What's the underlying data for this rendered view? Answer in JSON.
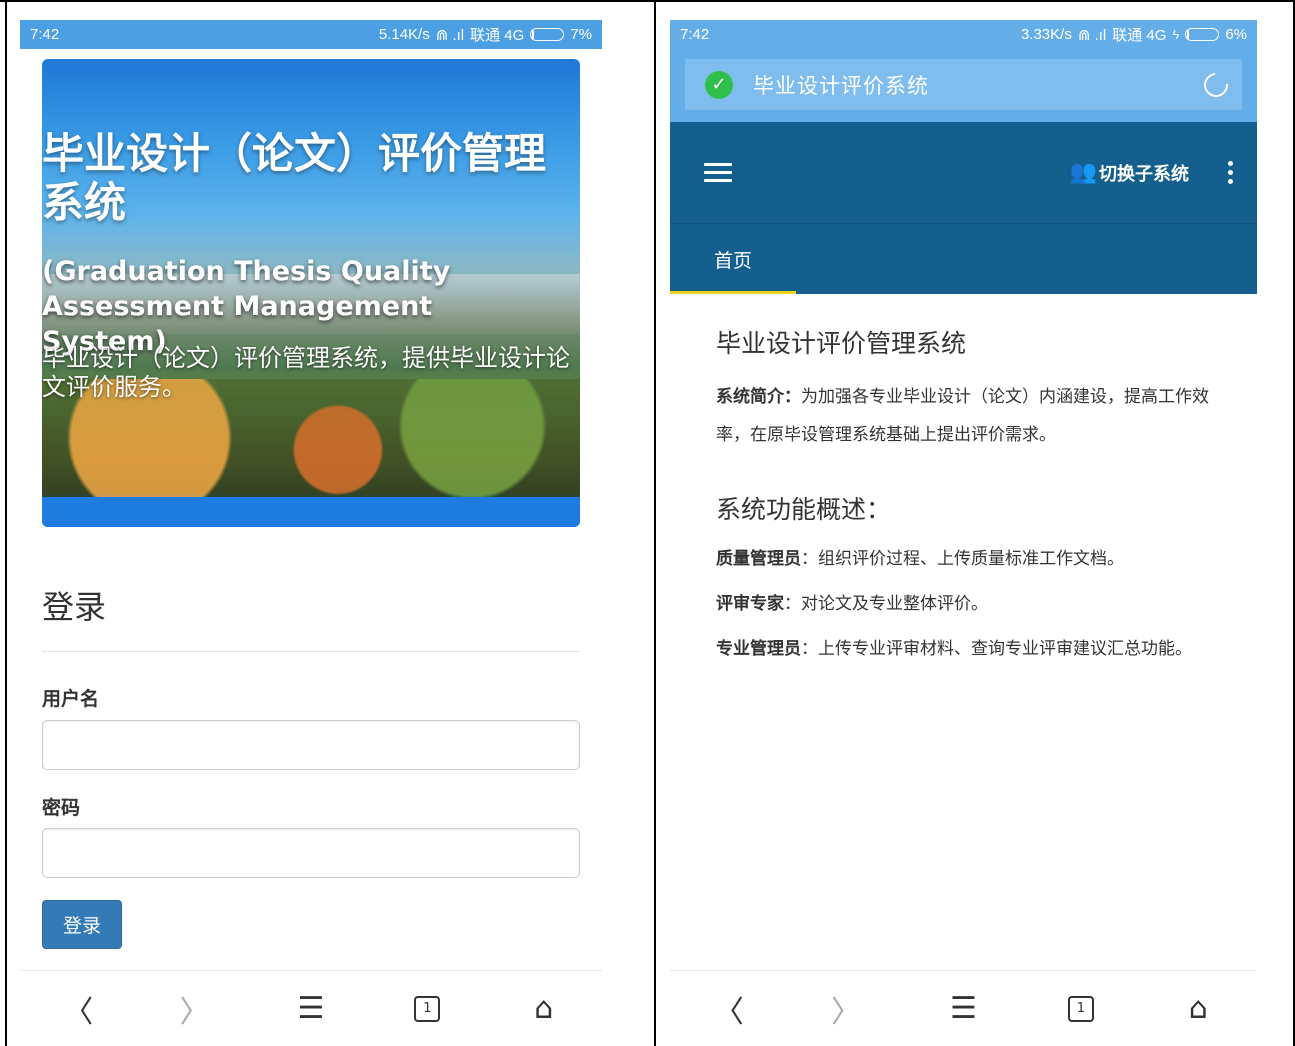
{
  "left_phone": {
    "status": {
      "time": "7:42",
      "speed": "5.14K/s",
      "network_icons": "⋒ .ıl",
      "carrier": "联通 4G",
      "battery_pct": "7%",
      "battery_level": 0.07
    },
    "hero": {
      "title": "毕业设计（论文）评价管理系统",
      "subtitle": "(Graduation Thesis Quality Assessment Management System)",
      "description": "毕业设计（论文）评价管理系统，提供毕业设计论文评价服务。"
    },
    "login": {
      "heading": "登录",
      "username_label": "用户名",
      "username_value": "",
      "password_label": "密码",
      "password_value": "",
      "submit_label": "登录"
    },
    "browser_nav": {
      "back": "〈",
      "forward": "〉",
      "menu": "☰",
      "tabs_count": "1",
      "home": "⌂"
    }
  },
  "right_phone": {
    "status": {
      "time": "7:42",
      "speed": "3.33K/s",
      "network_icons": "⋒ .ıl",
      "carrier": "联通 4G",
      "charging": "ϟ",
      "battery_pct": "6%",
      "battery_level": 0.06
    },
    "address_bar": {
      "text": "毕业设计评价系统",
      "secure_icon": "shield-check-icon",
      "reload_icon": "reload-icon"
    },
    "app_bar": {
      "switch_label": "切换子系统",
      "menu_icon": "hamburger-icon",
      "more_icon": "kebab-icon"
    },
    "tabs": [
      {
        "label": "首页",
        "active": true
      }
    ],
    "content": {
      "title": "毕业设计评价管理系统",
      "intro_label": "系统简介：",
      "intro_text": "为加强各专业毕业设计（论文）内涵建设，提高工作效率，在原毕设管理系统基础上提出评价需求。",
      "features_heading": "系统功能概述：",
      "features": [
        {
          "role": "质量管理员",
          "desc": "：组织评价过程、上传质量标准工作文档。"
        },
        {
          "role": "评审专家",
          "desc": "：对论文及专业整体评价。"
        },
        {
          "role": "专业管理员",
          "desc": "：上传专业评审材料、查询专业评审建议汇总功能。"
        }
      ]
    },
    "browser_nav": {
      "back": "〈",
      "forward": "〉",
      "menu": "☰",
      "tabs_count": "1",
      "home": "⌂"
    }
  },
  "colors": {
    "status_left": "#4d9fe3",
    "status_right": "#63aee9",
    "appbar": "#145f8e",
    "tab_indicator": "#f1d31f",
    "button_primary": "#337ab7"
  }
}
